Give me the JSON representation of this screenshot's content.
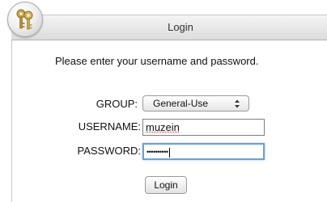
{
  "dialog": {
    "title": "Login",
    "icon": "keys-icon"
  },
  "prompt": "Please enter your username and password.",
  "form": {
    "group_label": "GROUP:",
    "group_selected": "General-Use",
    "username_label": "USERNAME:",
    "username_value": "muzein",
    "password_label": "PASSWORD:",
    "password_masked": "••••••••••",
    "login_button": "Login"
  },
  "colors": {
    "focus_ring": "#6a9fd8",
    "spellcheck_underline": "#d23a3a"
  }
}
